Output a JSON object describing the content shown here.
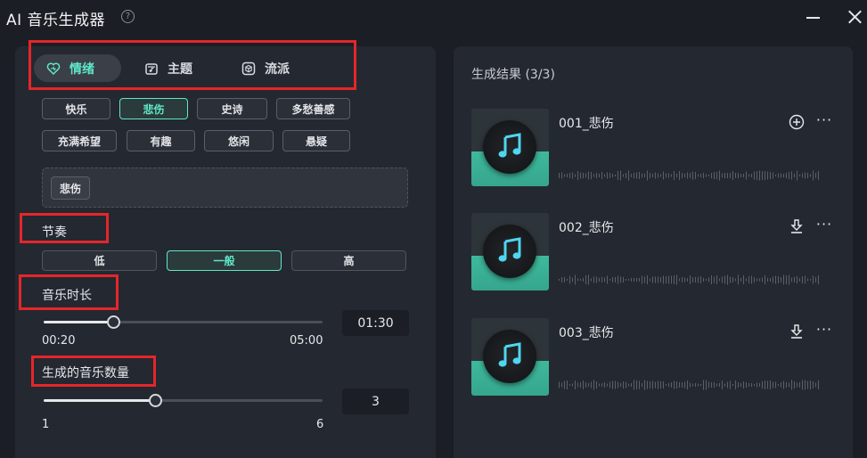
{
  "window": {
    "title": "AI 音乐生成器",
    "help_symbol": "?"
  },
  "tabs": [
    {
      "label": "情绪",
      "icon": "heart-icon",
      "active": true
    },
    {
      "label": "主题",
      "icon": "music-box-icon",
      "active": false
    },
    {
      "label": "流派",
      "icon": "cube-icon",
      "active": false
    }
  ],
  "moods": [
    "快乐",
    "悲伤",
    "史诗",
    "多愁善感",
    "充满希望",
    "有趣",
    "悠闲",
    "悬疑"
  ],
  "selected_mood": "悲伤",
  "selected_tags": [
    "悲伤"
  ],
  "tempo": {
    "label": "节奏",
    "options": [
      "低",
      "一般",
      "高"
    ],
    "selected": "一般"
  },
  "duration": {
    "label": "音乐时长",
    "min": "00:20",
    "max": "05:00",
    "value": "01:30",
    "fraction": 0.25
  },
  "count": {
    "label": "生成的音乐数量",
    "min": "1",
    "max": "6",
    "value": "3",
    "fraction": 0.4
  },
  "results": {
    "title": "生成结果 (3/3)",
    "items": [
      {
        "name": "001_悲伤",
        "action": "add-icon"
      },
      {
        "name": "002_悲伤",
        "action": "download-icon"
      },
      {
        "name": "003_悲伤",
        "action": "download-icon"
      }
    ]
  },
  "colors": {
    "accent": "#5ee8c8",
    "highlight": "#e5262a",
    "background": "#1b1e24",
    "panel": "#242830"
  }
}
